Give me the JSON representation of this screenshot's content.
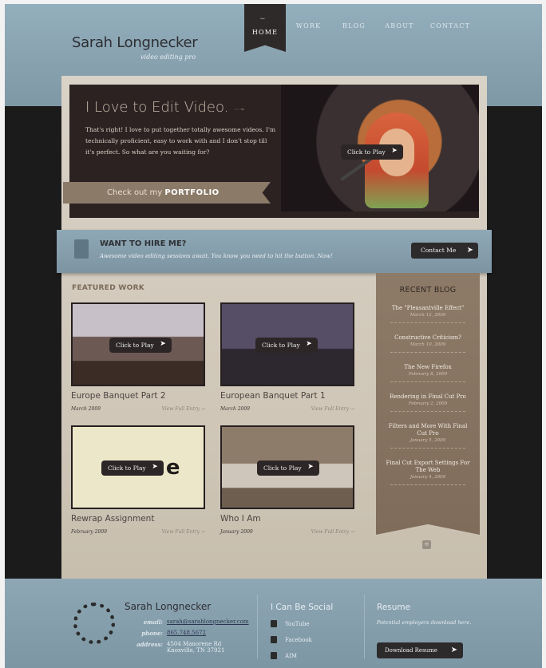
{
  "header": {
    "brand_name": "Sarah Longnecker",
    "brand_tagline": "video editing pro",
    "nav": [
      "HOME",
      "WORK",
      "BLOG",
      "ABOUT",
      "CONTACT"
    ],
    "active_nav": "HOME"
  },
  "hero": {
    "title": "I Love to Edit Video.",
    "text": "That's right! I love to put together totally awesome videos. I'm technically proficient, easy to work with and I don't stop till it's perfect. So what are you waiting for?",
    "play_label": "Click to Play",
    "portfolio_prefix": "Check out my",
    "portfolio_word": "PORTFOLIO"
  },
  "hire": {
    "title": "WANT TO HIRE ME?",
    "subtitle": "Awesome video editing sessions await. You know you need to hit the button. Now!",
    "button": "Contact Me"
  },
  "featured": {
    "title": "FEATURED WORK",
    "play_label": "Click to Play",
    "more_label": "View Full Entry →",
    "items": [
      {
        "title": "Europe Banquet Part 2",
        "date": "March 2009"
      },
      {
        "title": "European Banquet Part 1",
        "date": "March 2009"
      },
      {
        "title": "Rewrap Assignment",
        "date": "February 2009"
      },
      {
        "title": "Who I Am",
        "date": "January 2009"
      }
    ],
    "rewrap_text": "rewrap"
  },
  "blog": {
    "title": "RECENT BLOG",
    "items": [
      {
        "title": "The \"Pleasantville Effect\"",
        "date": "March 12, 2009"
      },
      {
        "title": "Constructive Criticism?",
        "date": "March 10, 2009"
      },
      {
        "title": "The New Firefox",
        "date": "February 8, 2009"
      },
      {
        "title": "Rendering in Final Cut Pro",
        "date": "February 2, 2009"
      },
      {
        "title": "Filters and More With Final Cut Pro",
        "date": "January 5, 2009"
      },
      {
        "title": "Final Cut Export Settings For The Web",
        "date": "January 4, 2009"
      }
    ],
    "more": "more"
  },
  "footer": {
    "name": "Sarah Longnecker",
    "email_label": "email:",
    "email": "sarah@sarahlongnecker.com",
    "phone_label": "phone:",
    "phone": "865.748.5672",
    "address_label": "address:",
    "address_line1": "4504 Manorene Rd",
    "address_line2": "Knoxville, TN 37921",
    "social_title": "I Can Be Social",
    "social": [
      "YouTube",
      "Facebook",
      "AIM"
    ],
    "resume_title": "Resume",
    "resume_text": "Potential employers download here.",
    "resume_button": "Download Resume"
  }
}
